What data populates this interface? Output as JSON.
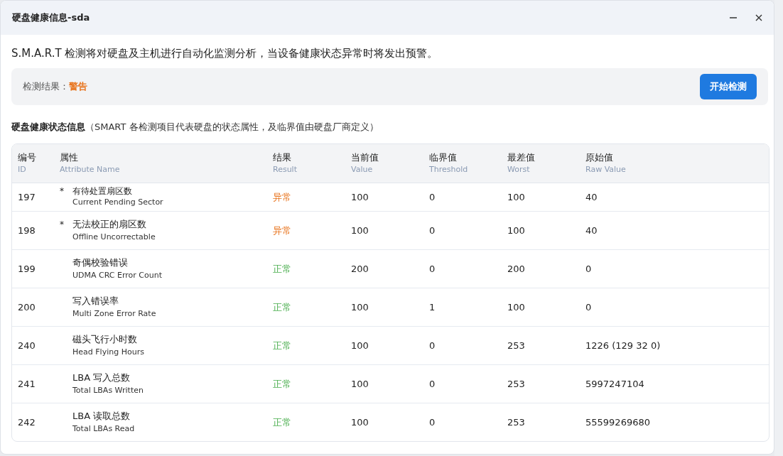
{
  "window": {
    "title": "硬盘健康信息-sda"
  },
  "description": "S.M.A.R.T 检测将对硬盘及主机进行自动化监测分析，当设备健康状态异常时将发出预警。",
  "result_panel": {
    "label": "检测结果：",
    "value": "警告",
    "color": "#e8731c",
    "button": "开始检测"
  },
  "section": {
    "title": "硬盘健康状态信息",
    "note": "（SMART 各检测项目代表硬盘的状态属性，及临界值由硬盘厂商定义）"
  },
  "table": {
    "columns": [
      {
        "label": "编号",
        "sub": "ID"
      },
      {
        "label": "属性",
        "sub": "Attribute Name"
      },
      {
        "label": "结果",
        "sub": "Result"
      },
      {
        "label": "当前值",
        "sub": "Value"
      },
      {
        "label": "临界值",
        "sub": "Threshold"
      },
      {
        "label": "最差值",
        "sub": "Worst"
      },
      {
        "label": "原始值",
        "sub": "Raw Value"
      }
    ],
    "rows": [
      {
        "id": "197",
        "marker": "*",
        "name": "有待处置扇区数",
        "name_en": "Current Pending Sector",
        "result": "异常",
        "color": "#e8731c",
        "value": "100",
        "threshold": "0",
        "worst": "100",
        "raw": "40"
      },
      {
        "id": "198",
        "marker": "*",
        "name": "无法校正的扇区数",
        "name_en": "Offline Uncorrectable",
        "result": "异常",
        "color": "#e8731c",
        "value": "100",
        "threshold": "0",
        "worst": "100",
        "raw": "40"
      },
      {
        "id": "199",
        "name": "奇偶校验错误",
        "name_en": "UDMA CRC Error Count",
        "result": "正常",
        "color": "#4caf50",
        "value": "200",
        "threshold": "0",
        "worst": "200",
        "raw": "0"
      },
      {
        "id": "200",
        "name": "写入错误率",
        "name_en": "Multi Zone Error Rate",
        "result": "正常",
        "color": "#4caf50",
        "value": "100",
        "threshold": "1",
        "worst": "100",
        "raw": "0"
      },
      {
        "id": "240",
        "name": "磁头飞行小时数",
        "name_en": "Head Flying Hours",
        "result": "正常",
        "color": "#4caf50",
        "value": "100",
        "threshold": "0",
        "worst": "253",
        "raw": "1226 (129 32 0)"
      },
      {
        "id": "241",
        "name": "LBA 写入总数",
        "name_en": "Total LBAs Written",
        "result": "正常",
        "color": "#4caf50",
        "value": "100",
        "threshold": "0",
        "worst": "253",
        "raw": "5997247104"
      },
      {
        "id": "242",
        "name": "LBA 读取总数",
        "name_en": "Total LBAs Read",
        "result": "正常",
        "color": "#4caf50",
        "value": "100",
        "threshold": "0",
        "worst": "253",
        "raw": "55599269680"
      }
    ]
  }
}
